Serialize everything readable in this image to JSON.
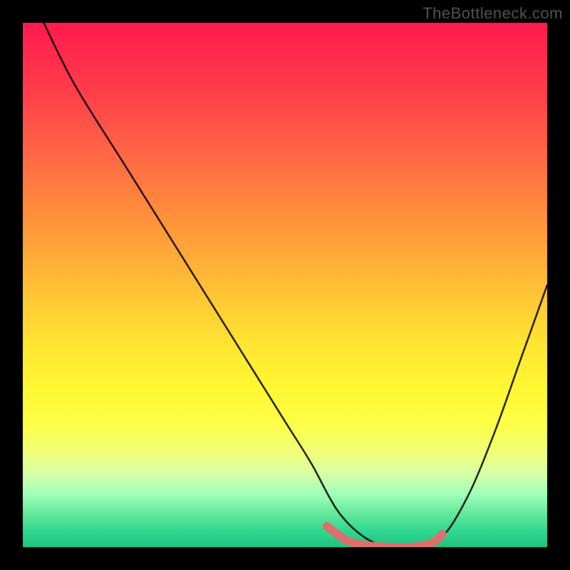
{
  "watermark": "TheBottleneck.com",
  "chart_data": {
    "type": "line",
    "title": "",
    "xlabel": "",
    "ylabel": "",
    "xlim": [
      0,
      100
    ],
    "ylim": [
      0,
      100
    ],
    "grid": false,
    "legend": false,
    "series": [
      {
        "name": "bottleneck-curve",
        "color": "#000000",
        "x": [
          4,
          10,
          20,
          30,
          40,
          50,
          55,
          60,
          65,
          70,
          75,
          80,
          85,
          90,
          95,
          100
        ],
        "y": [
          100,
          88,
          72,
          56,
          40,
          24,
          16,
          7,
          2,
          0,
          0,
          2,
          10,
          22,
          36,
          50
        ]
      },
      {
        "name": "optimal-zone-marker",
        "color": "#e07070",
        "x": [
          58,
          62,
          66,
          70,
          74,
          78,
          80
        ],
        "y": [
          4,
          1.2,
          0.3,
          0,
          0,
          0.8,
          2.5
        ]
      }
    ],
    "gradient_stops": [
      {
        "pct": 0,
        "color": "#ff1a4f"
      },
      {
        "pct": 50,
        "color": "#ffc535"
      },
      {
        "pct": 75,
        "color": "#fcff4a"
      },
      {
        "pct": 100,
        "color": "#1fc47e"
      }
    ]
  }
}
